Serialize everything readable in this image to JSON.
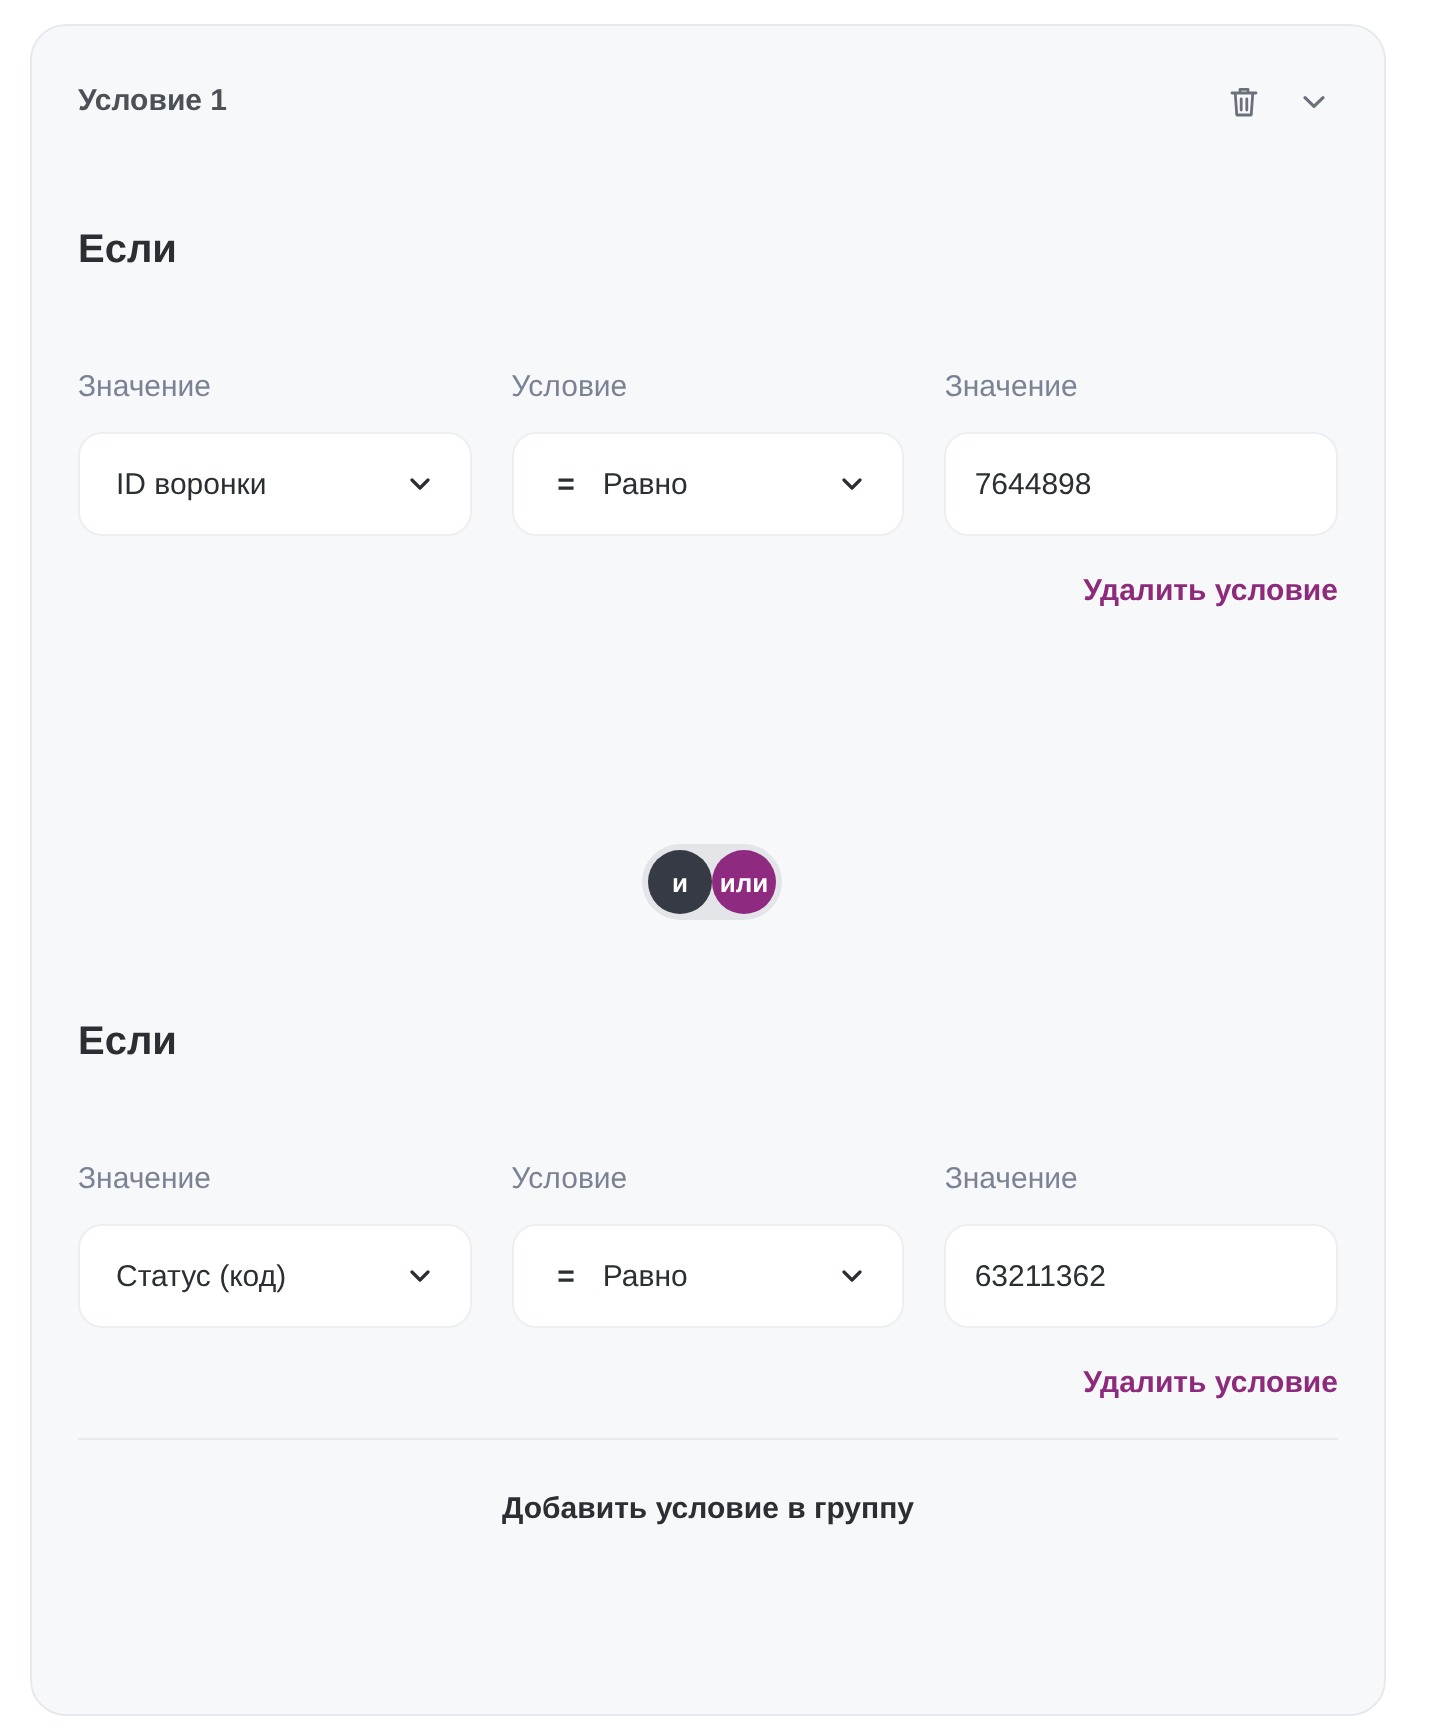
{
  "condition": {
    "title": "Условие 1",
    "items": [
      {
        "kind": "rule",
        "heading": "Если",
        "fields": [
          {
            "kind": "select",
            "label": "Значение",
            "value": "ID воронки"
          },
          {
            "kind": "select",
            "label": "Условие",
            "operator": "=",
            "value": "Равно"
          },
          {
            "kind": "input",
            "label": "Значение",
            "value": "7644898"
          }
        ],
        "remove_link": "Удалить условие"
      },
      {
        "kind": "connector",
        "options": [
          {
            "label": "и",
            "selected": false
          },
          {
            "label": "или",
            "selected": true
          }
        ]
      },
      {
        "kind": "rule",
        "heading": "Если",
        "fields": [
          {
            "kind": "select",
            "label": "Значение",
            "value": "Статус (код)"
          },
          {
            "kind": "select",
            "label": "Условие",
            "operator": "=",
            "value": "Равно"
          },
          {
            "kind": "input",
            "label": "Значение",
            "value": "63211362"
          }
        ],
        "remove_link": "Удалить условие"
      }
    ],
    "add_button": "Добавить условие в группу"
  }
}
